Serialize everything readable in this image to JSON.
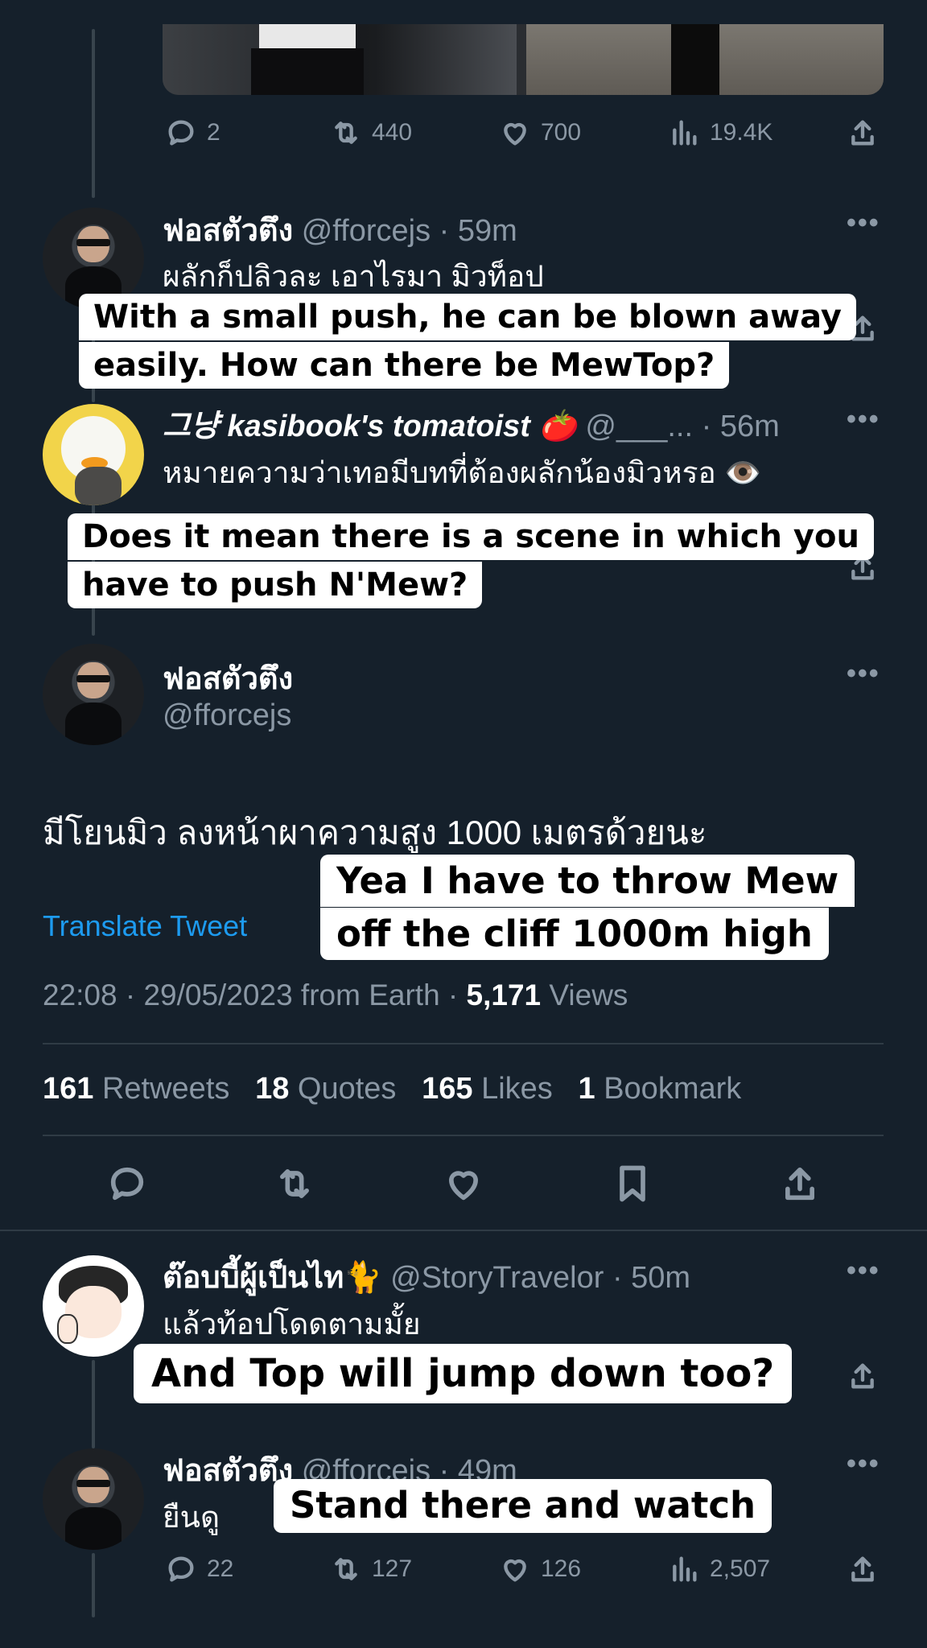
{
  "top_tweet": {
    "stats": {
      "replies": "2",
      "retweets": "440",
      "likes": "700",
      "views": "19.4K"
    }
  },
  "reply1": {
    "name": "ฟอสตัวตึง",
    "handle": "@fforcejs",
    "time": "59m",
    "text": "ผลักก็ปลิวละ เอาไรมา มิวท็อป",
    "caption_line1": "With a small push, he can be blown away",
    "caption_line2": "easily. How can there be MewTop?"
  },
  "reply2": {
    "name": "그냥 kasibook's tomatoist 🍅",
    "handle": "@___...",
    "time": "56m",
    "text": "หมายความว่าเทอมีบทที่ต้องผลักน้องมิวหรอ 👁️",
    "caption_line1": "Does it mean there is a scene in which you",
    "caption_line2": "have to push N'Mew?"
  },
  "main_tweet": {
    "name": "ฟอสตัวตึง",
    "handle": "@fforcejs",
    "text": "มีโยนมิว ลงหน้าผาความสูง 1000 เมตรด้วยนะ",
    "translate": "Translate Tweet",
    "caption_line1": "Yea I have to throw Mew",
    "caption_line2": "off the cliff 1000m high",
    "meta": "22:08 · 29/05/2023 from Earth · ",
    "views_count": "5,171",
    "views_label": " Views",
    "retweets_count": "161",
    "retweets_label": "Retweets",
    "quotes_count": "18",
    "quotes_label": "Quotes",
    "likes_count": "165",
    "likes_label": "Likes",
    "bookmarks_count": "1",
    "bookmarks_label": "Bookmark"
  },
  "reply3": {
    "name": "ต๊อบบี้ผู้เป็นไท🐈",
    "handle": "@StoryTravelor",
    "time": "50m",
    "text": "แล้วท้อปโดดตามมั้ย",
    "caption": "And Top will jump down too?"
  },
  "reply4": {
    "name": "ฟอสตัวตึง",
    "handle": "@fforcejs",
    "time": "49m",
    "text": "ยืนดู",
    "caption": "Stand there and watch",
    "stats": {
      "replies": "22",
      "retweets": "127",
      "likes": "126",
      "views": "2,507"
    }
  },
  "ui": {
    "more_symbol": "•••",
    "dot": "·"
  }
}
